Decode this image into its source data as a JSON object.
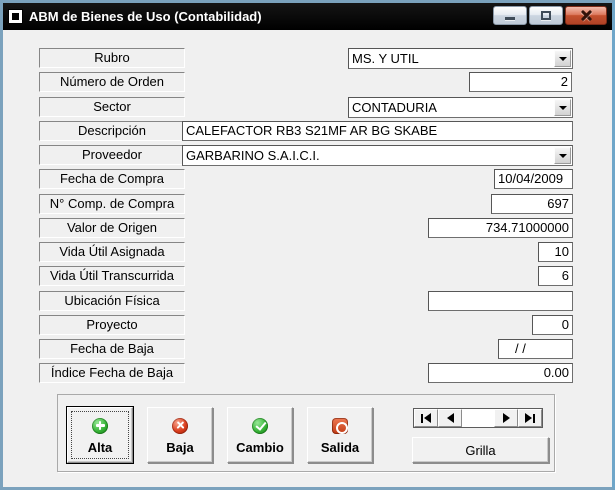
{
  "window": {
    "title": "ABM de Bienes de Uso (Contabilidad)",
    "titlebar_color": "#000000",
    "border_color": "#7ba2bd",
    "caption_buttons": [
      "minimize",
      "restore",
      "close"
    ]
  },
  "form": {
    "fields": [
      {
        "name": "rubro",
        "label": "Rubro",
        "type": "combo",
        "value": "MS. Y UTIL"
      },
      {
        "name": "numero-de-orden",
        "label": "Número de Orden",
        "type": "text",
        "value": "2",
        "align": "right"
      },
      {
        "name": "sector",
        "label": "Sector",
        "type": "combo",
        "value": "CONTADURIA"
      },
      {
        "name": "descripcion",
        "label": "Descripción",
        "type": "text",
        "value": "CALEFACTOR RB3 S21MF AR BG SKABE",
        "align": "left"
      },
      {
        "name": "proveedor",
        "label": "Proveedor",
        "type": "combo",
        "value": "GARBARINO S.A.I.C.I."
      },
      {
        "name": "fecha-de-compra",
        "label": "Fecha de Compra",
        "type": "text",
        "value": "10/04/2009",
        "align": "left"
      },
      {
        "name": "n-comp-de-compra",
        "label": "N° Comp. de Compra",
        "type": "text",
        "value": "697",
        "align": "right"
      },
      {
        "name": "valor-de-origen",
        "label": "Valor de Origen",
        "type": "text",
        "value": "734.71000000",
        "align": "right"
      },
      {
        "name": "vida-util-asignada",
        "label": "Vida Útil Asignada",
        "type": "text",
        "value": "10",
        "align": "right"
      },
      {
        "name": "vida-util-transcurrida",
        "label": "Vida Útil Transcurrida",
        "type": "text",
        "value": "6",
        "align": "right"
      },
      {
        "name": "ubicacion-fisica",
        "label": "Ubicación Física",
        "type": "text",
        "value": "",
        "align": "left"
      },
      {
        "name": "proyecto",
        "label": "Proyecto",
        "type": "text",
        "value": "0",
        "align": "right"
      },
      {
        "name": "fecha-de-baja",
        "label": "Fecha de Baja",
        "type": "text",
        "value": "/ /",
        "align": "left",
        "indent": true
      },
      {
        "name": "indice-fecha-de-baja",
        "label": "Índice Fecha de Baja",
        "type": "text",
        "value": "0.00",
        "align": "right"
      }
    ]
  },
  "actions": [
    {
      "name": "alta",
      "label": "Alta",
      "icon": "plus-circle-icon",
      "icon_color": "#2ca02c",
      "focused": true
    },
    {
      "name": "baja",
      "label": "Baja",
      "icon": "cross-circle-icon",
      "icon_color": "#d23418",
      "focused": false
    },
    {
      "name": "cambio",
      "label": "Cambio",
      "icon": "check-circle-icon",
      "icon_color": "#2ca02c",
      "focused": false
    },
    {
      "name": "salida",
      "label": "Salida",
      "icon": "power-icon",
      "icon_color": "#d2431e",
      "focused": false
    }
  ],
  "navigator": {
    "buttons": [
      "first",
      "previous",
      "next",
      "last"
    ]
  },
  "grilla": {
    "label": "Grilla"
  }
}
